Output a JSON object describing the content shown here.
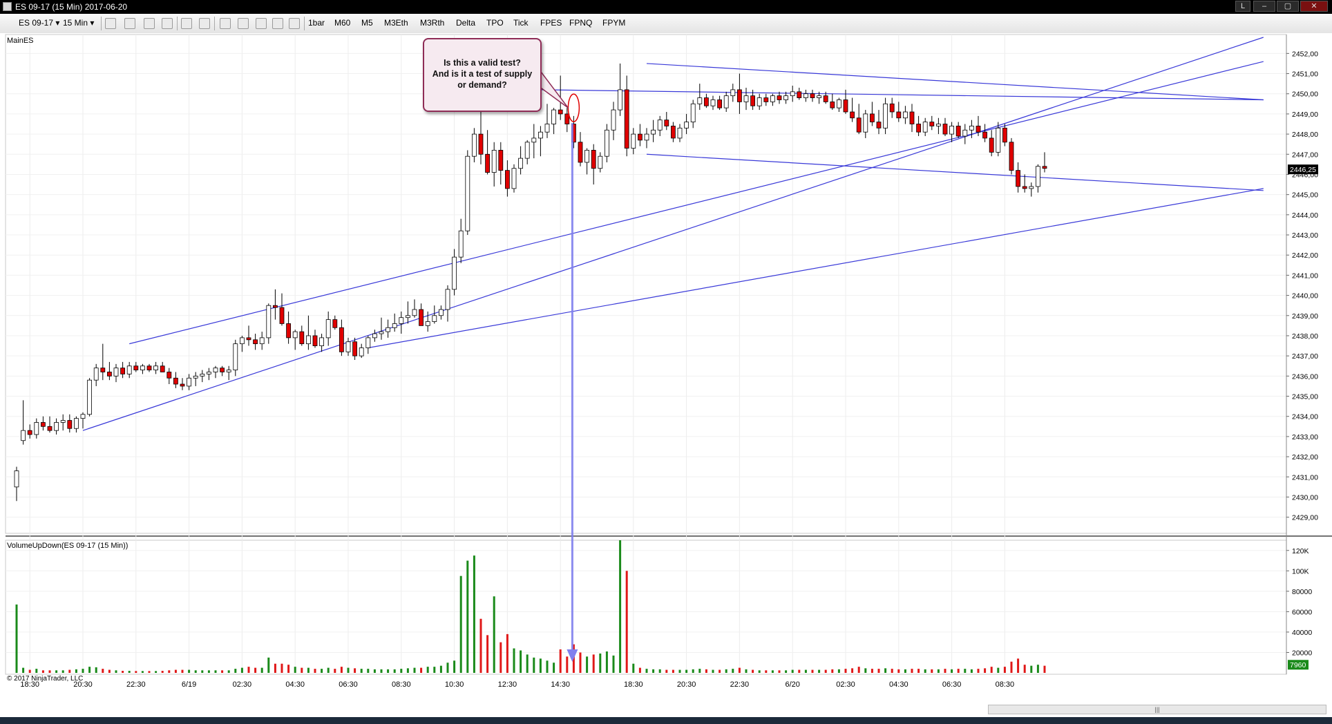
{
  "window": {
    "title": "ES 09-17 (15 Min)  2017-06-20",
    "buttons": [
      "L",
      "–",
      "▢",
      "✕"
    ]
  },
  "toolbar": {
    "instrument": "ES 09-17 ▾",
    "interval": "15 Min ▾",
    "buttons": [
      "1bar",
      "M60",
      "M5",
      "M3Eth",
      "M3Rth",
      "Delta",
      "TPO",
      "Tick",
      "FPES",
      "FPNQ",
      "FPYM"
    ]
  },
  "panels": {
    "price_label": "MainES",
    "volume_label": "VolumeUpDown(ES 09-17 (15 Min))",
    "copyright": "© 2017 NinjaTrader, LLC"
  },
  "callout": {
    "line1": "Is this a valid test?",
    "line2": "And is it a test of supply",
    "line3": "or demand?"
  },
  "chart_data": {
    "type": "candlestick",
    "x_tick_labels": [
      {
        "index": 2,
        "label": "18:30"
      },
      {
        "index": 10,
        "label": "20:30"
      },
      {
        "index": 18,
        "label": "22:30"
      },
      {
        "index": 26,
        "label": "6/19"
      },
      {
        "index": 34,
        "label": "02:30"
      },
      {
        "index": 42,
        "label": "04:30"
      },
      {
        "index": 50,
        "label": "06:30"
      },
      {
        "index": 58,
        "label": "08:30"
      },
      {
        "index": 66,
        "label": "10:30"
      },
      {
        "index": 74,
        "label": "12:30"
      },
      {
        "index": 82,
        "label": "14:30"
      },
      {
        "index": 93,
        "label": "18:30"
      },
      {
        "index": 101,
        "label": "20:30"
      },
      {
        "index": 109,
        "label": "22:30"
      },
      {
        "index": 117,
        "label": "6/20"
      },
      {
        "index": 125,
        "label": "02:30"
      },
      {
        "index": 133,
        "label": "04:30"
      },
      {
        "index": 141,
        "label": "06:30"
      },
      {
        "index": 149,
        "label": "08:30"
      }
    ],
    "price_axis": {
      "ylim": [
        2428.2,
        2452.8
      ],
      "ticks": [
        "2429,00",
        "2430,00",
        "2431,00",
        "2432,00",
        "2433,00",
        "2434,00",
        "2435,00",
        "2436,00",
        "2437,00",
        "2438,00",
        "2439,00",
        "2440,00",
        "2441,00",
        "2442,00",
        "2443,00",
        "2444,00",
        "2445,00",
        "2446,00",
        "2447,00",
        "2448,00",
        "2449,00",
        "2450,00",
        "2451,00",
        "2452,00"
      ],
      "last_price": "2446,25"
    },
    "volume_axis": {
      "ylim": [
        0,
        130000
      ],
      "ticks": [
        "20000",
        "40000",
        "60000",
        "80000",
        "100K",
        "120K"
      ],
      "last_volume": "7960"
    },
    "bars": [
      [
        2430.5,
        2431.5,
        2429.8,
        2431.3,
        67000
      ],
      [
        2432.8,
        2434.8,
        2432.6,
        2433.3,
        5000
      ],
      [
        2433.3,
        2433.6,
        2432.9,
        2433.1,
        3000
      ],
      [
        2433.1,
        2433.9,
        2432.9,
        2433.7,
        4000
      ],
      [
        2433.7,
        2434.0,
        2433.3,
        2433.5,
        2500
      ],
      [
        2433.5,
        2434.0,
        2433.2,
        2433.3,
        2500
      ],
      [
        2433.3,
        2433.9,
        2433.1,
        2433.7,
        2500
      ],
      [
        2433.7,
        2434.1,
        2433.3,
        2433.8,
        2500
      ],
      [
        2433.8,
        2434.1,
        2433.2,
        2433.4,
        3000
      ],
      [
        2433.4,
        2434.0,
        2433.2,
        2433.9,
        3500
      ],
      [
        2433.9,
        2434.2,
        2433.4,
        2434.1,
        4000
      ],
      [
        2434.1,
        2435.9,
        2434.0,
        2435.8,
        6000
      ],
      [
        2435.8,
        2436.6,
        2435.5,
        2436.4,
        5500
      ],
      [
        2436.4,
        2437.6,
        2435.8,
        2436.2,
        4000
      ],
      [
        2436.2,
        2436.7,
        2435.8,
        2436.0,
        3000
      ],
      [
        2436.0,
        2436.6,
        2435.7,
        2436.4,
        2500
      ],
      [
        2436.4,
        2436.7,
        2435.9,
        2436.1,
        2000
      ],
      [
        2436.1,
        2436.7,
        2435.9,
        2436.5,
        2000
      ],
      [
        2436.5,
        2436.7,
        2436.2,
        2436.3,
        1800
      ],
      [
        2436.3,
        2436.6,
        2436.1,
        2436.5,
        1800
      ],
      [
        2436.5,
        2436.6,
        2436.2,
        2436.3,
        1800
      ],
      [
        2436.3,
        2436.7,
        2436.1,
        2436.5,
        1800
      ],
      [
        2436.5,
        2436.7,
        2436.2,
        2436.2,
        2000
      ],
      [
        2436.2,
        2436.4,
        2435.6,
        2435.9,
        2500
      ],
      [
        2435.9,
        2436.2,
        2435.4,
        2435.6,
        3000
      ],
      [
        2435.6,
        2435.9,
        2435.3,
        2435.5,
        3000
      ],
      [
        2435.5,
        2436.1,
        2435.3,
        2435.9,
        3000
      ],
      [
        2435.9,
        2436.2,
        2435.5,
        2436.0,
        2500
      ],
      [
        2436.0,
        2436.3,
        2435.7,
        2436.1,
        2500
      ],
      [
        2436.1,
        2436.4,
        2435.8,
        2436.2,
        2500
      ],
      [
        2436.2,
        2436.5,
        2435.9,
        2436.4,
        2500
      ],
      [
        2436.4,
        2436.5,
        2436.0,
        2436.2,
        2500
      ],
      [
        2436.2,
        2436.5,
        2435.8,
        2436.3,
        2500
      ],
      [
        2436.3,
        2437.8,
        2436.0,
        2437.6,
        4000
      ],
      [
        2437.6,
        2438.0,
        2437.2,
        2437.9,
        5000
      ],
      [
        2437.9,
        2438.5,
        2437.5,
        2437.8,
        6000
      ],
      [
        2437.8,
        2438.1,
        2437.3,
        2437.6,
        5000
      ],
      [
        2437.6,
        2438.2,
        2437.3,
        2437.9,
        5000
      ],
      [
        2437.9,
        2439.6,
        2437.6,
        2439.5,
        15000
      ],
      [
        2439.5,
        2440.3,
        2438.8,
        2439.4,
        9000
      ],
      [
        2439.4,
        2440.1,
        2438.5,
        2438.6,
        9000
      ],
      [
        2438.6,
        2439.2,
        2437.6,
        2437.9,
        8000
      ],
      [
        2437.9,
        2438.3,
        2437.3,
        2438.2,
        6000
      ],
      [
        2438.2,
        2438.5,
        2437.5,
        2437.6,
        5000
      ],
      [
        2437.6,
        2439.0,
        2437.3,
        2438.0,
        5000
      ],
      [
        2438.0,
        2438.3,
        2437.4,
        2437.5,
        4000
      ],
      [
        2437.5,
        2438.1,
        2437.2,
        2437.9,
        4000
      ],
      [
        2437.9,
        2439.2,
        2437.5,
        2438.8,
        5000
      ],
      [
        2438.8,
        2439.0,
        2438.3,
        2438.4,
        4000
      ],
      [
        2438.4,
        2438.8,
        2437.0,
        2437.2,
        6000
      ],
      [
        2437.2,
        2437.9,
        2437.0,
        2437.7,
        5000
      ],
      [
        2437.7,
        2437.9,
        2436.8,
        2437.0,
        4500
      ],
      [
        2437.0,
        2437.6,
        2436.9,
        2437.4,
        4000
      ],
      [
        2437.4,
        2438.0,
        2437.1,
        2437.9,
        4000
      ],
      [
        2437.9,
        2438.3,
        2437.7,
        2438.1,
        3500
      ],
      [
        2438.1,
        2438.9,
        2437.8,
        2438.2,
        3500
      ],
      [
        2438.2,
        2438.8,
        2437.9,
        2438.4,
        3500
      ],
      [
        2438.4,
        2439.1,
        2438.2,
        2438.6,
        3500
      ],
      [
        2438.6,
        2439.2,
        2438.1,
        2438.9,
        4000
      ],
      [
        2438.9,
        2439.7,
        2438.6,
        2439.0,
        4500
      ],
      [
        2439.0,
        2439.8,
        2438.9,
        2439.3,
        5000
      ],
      [
        2439.3,
        2439.6,
        2438.5,
        2438.5,
        5000
      ],
      [
        2438.5,
        2439.2,
        2438.2,
        2438.7,
        6000
      ],
      [
        2438.7,
        2439.5,
        2438.6,
        2439.0,
        6000
      ],
      [
        2439.0,
        2439.5,
        2438.8,
        2439.3,
        7000
      ],
      [
        2439.3,
        2440.5,
        2438.7,
        2440.3,
        10000
      ],
      [
        2440.3,
        2442.3,
        2440.0,
        2441.9,
        12000
      ],
      [
        2441.9,
        2443.8,
        2441.6,
        2443.2,
        95000
      ],
      [
        2443.2,
        2447.2,
        2443.0,
        2446.9,
        110000
      ],
      [
        2446.9,
        2448.3,
        2446.6,
        2448.0,
        115000
      ],
      [
        2448.0,
        2449.5,
        2446.5,
        2447.0,
        53000
      ],
      [
        2447.0,
        2448.2,
        2446.0,
        2446.1,
        37000
      ],
      [
        2446.1,
        2447.6,
        2445.4,
        2447.2,
        75000
      ],
      [
        2447.2,
        2447.6,
        2445.5,
        2446.2,
        30000
      ],
      [
        2446.2,
        2446.7,
        2444.9,
        2445.3,
        38000
      ],
      [
        2445.3,
        2446.5,
        2445.1,
        2446.3,
        24000
      ],
      [
        2446.3,
        2447.4,
        2446.0,
        2446.8,
        22000
      ],
      [
        2446.8,
        2447.7,
        2446.5,
        2447.6,
        18000
      ],
      [
        2447.6,
        2448.5,
        2446.8,
        2447.8,
        15000
      ],
      [
        2447.8,
        2448.4,
        2446.9,
        2448.1,
        14000
      ],
      [
        2448.1,
        2449.5,
        2447.8,
        2448.5,
        12000
      ],
      [
        2448.5,
        2449.3,
        2448.0,
        2449.2,
        10000
      ],
      [
        2449.2,
        2450.9,
        2448.7,
        2449.0,
        23000
      ],
      [
        2449.0,
        2449.3,
        2448.1,
        2448.5,
        16000
      ],
      [
        2448.5,
        2448.9,
        2447.3,
        2447.6,
        28000
      ],
      [
        2447.6,
        2448.1,
        2446.4,
        2446.6,
        20000
      ],
      [
        2446.6,
        2447.3,
        2446.0,
        2447.2,
        16000
      ],
      [
        2447.2,
        2447.5,
        2445.5,
        2446.3,
        18000
      ],
      [
        2446.3,
        2447.1,
        2446.1,
        2446.9,
        19000
      ],
      [
        2446.9,
        2448.5,
        2446.6,
        2448.2,
        21000
      ],
      [
        2448.2,
        2449.6,
        2447.7,
        2449.2,
        17000
      ],
      [
        2449.2,
        2451.5,
        2448.9,
        2450.2,
        130000
      ],
      [
        2450.2,
        2450.9,
        2446.9,
        2447.3,
        100000
      ],
      [
        2447.3,
        2448.3,
        2447.0,
        2448.0,
        9000
      ],
      [
        2448.0,
        2448.5,
        2447.4,
        2447.7,
        5000
      ],
      [
        2447.7,
        2448.3,
        2447.3,
        2448.0,
        4000
      ],
      [
        2448.0,
        2448.7,
        2447.6,
        2448.2,
        3500
      ],
      [
        2448.2,
        2448.9,
        2447.9,
        2448.7,
        3500
      ],
      [
        2448.7,
        2449.1,
        2448.2,
        2448.4,
        3000
      ],
      [
        2448.4,
        2448.6,
        2447.6,
        2447.8,
        3000
      ],
      [
        2447.8,
        2448.5,
        2447.6,
        2448.3,
        3000
      ],
      [
        2448.3,
        2449.0,
        2448.0,
        2448.6,
        3000
      ],
      [
        2448.6,
        2449.7,
        2448.3,
        2449.5,
        3500
      ],
      [
        2449.5,
        2450.5,
        2449.2,
        2449.8,
        4000
      ],
      [
        2449.8,
        2450.0,
        2449.3,
        2449.4,
        3500
      ],
      [
        2449.4,
        2449.9,
        2449.2,
        2449.7,
        3000
      ],
      [
        2449.7,
        2449.9,
        2449.2,
        2449.3,
        3000
      ],
      [
        2449.3,
        2450.1,
        2449.1,
        2449.9,
        3500
      ],
      [
        2449.9,
        2450.5,
        2449.6,
        2450.2,
        4000
      ],
      [
        2450.2,
        2451.0,
        2449.0,
        2449.6,
        5000
      ],
      [
        2449.6,
        2450.3,
        2449.2,
        2449.9,
        3500
      ],
      [
        2449.9,
        2450.2,
        2449.2,
        2449.4,
        3000
      ],
      [
        2449.4,
        2450.0,
        2449.2,
        2449.8,
        2500
      ],
      [
        2449.8,
        2450.0,
        2449.4,
        2449.6,
        2500
      ],
      [
        2449.6,
        2450.0,
        2449.4,
        2449.9,
        2500
      ],
      [
        2449.9,
        2450.1,
        2449.5,
        2449.7,
        2500
      ],
      [
        2449.7,
        2450.1,
        2449.5,
        2449.9,
        2500
      ],
      [
        2449.9,
        2450.4,
        2449.6,
        2450.1,
        3000
      ],
      [
        2450.1,
        2450.3,
        2449.7,
        2449.8,
        3000
      ],
      [
        2449.8,
        2450.2,
        2449.6,
        2450.0,
        3000
      ],
      [
        2450.0,
        2450.2,
        2449.6,
        2449.8,
        3000
      ],
      [
        2449.8,
        2450.1,
        2449.5,
        2449.9,
        3000
      ],
      [
        2449.9,
        2450.1,
        2449.5,
        2449.6,
        3000
      ],
      [
        2449.6,
        2450.0,
        2449.2,
        2449.3,
        3500
      ],
      [
        2449.3,
        2449.8,
        2449.1,
        2449.7,
        3500
      ],
      [
        2449.7,
        2450.2,
        2449.0,
        2449.1,
        4000
      ],
      [
        2449.1,
        2449.8,
        2448.6,
        2448.8,
        4500
      ],
      [
        2448.8,
        2449.5,
        2448.0,
        2448.1,
        6000
      ],
      [
        2448.1,
        2449.2,
        2447.8,
        2449.0,
        4500
      ],
      [
        2449.0,
        2449.6,
        2448.4,
        2448.6,
        4000
      ],
      [
        2448.6,
        2449.2,
        2448.0,
        2448.3,
        4000
      ],
      [
        2448.3,
        2449.8,
        2448.0,
        2449.5,
        4500
      ],
      [
        2449.5,
        2449.8,
        2448.8,
        2449.1,
        4000
      ],
      [
        2449.1,
        2449.6,
        2448.6,
        2448.8,
        3500
      ],
      [
        2448.8,
        2449.4,
        2448.5,
        2449.1,
        3500
      ],
      [
        2449.1,
        2449.5,
        2448.1,
        2448.5,
        4000
      ],
      [
        2448.5,
        2448.9,
        2447.9,
        2448.1,
        4000
      ],
      [
        2448.1,
        2448.8,
        2447.9,
        2448.6,
        3500
      ],
      [
        2448.6,
        2448.9,
        2448.2,
        2448.4,
        3500
      ],
      [
        2448.4,
        2448.8,
        2448.0,
        2448.5,
        3500
      ],
      [
        2448.5,
        2448.8,
        2447.9,
        2448.0,
        4000
      ],
      [
        2448.0,
        2448.6,
        2447.6,
        2448.4,
        3500
      ],
      [
        2448.4,
        2448.6,
        2447.8,
        2447.9,
        4000
      ],
      [
        2447.9,
        2448.5,
        2447.5,
        2448.2,
        4000
      ],
      [
        2448.2,
        2448.7,
        2447.8,
        2448.4,
        3500
      ],
      [
        2448.4,
        2448.9,
        2447.9,
        2448.1,
        4000
      ],
      [
        2448.1,
        2448.5,
        2447.6,
        2447.8,
        4500
      ],
      [
        2447.8,
        2448.2,
        2446.9,
        2447.1,
        6000
      ],
      [
        2447.1,
        2448.6,
        2446.9,
        2448.3,
        5000
      ],
      [
        2448.3,
        2448.5,
        2447.4,
        2447.6,
        6000
      ],
      [
        2447.6,
        2447.8,
        2446.0,
        2446.2,
        11000
      ],
      [
        2446.2,
        2446.6,
        2445.1,
        2445.4,
        14000
      ],
      [
        2445.4,
        2446.0,
        2445.1,
        2445.3,
        8000
      ],
      [
        2445.3,
        2445.6,
        2444.9,
        2445.4,
        7000
      ],
      [
        2445.4,
        2446.5,
        2445.1,
        2446.4,
        8000
      ],
      [
        2446.4,
        2447.1,
        2446.1,
        2446.3,
        7000
      ]
    ],
    "trendlines": [
      {
        "from": [
          10,
          2433.3
        ],
        "to": [
          188,
          2452.8
        ]
      },
      {
        "from": [
          17,
          2437.6
        ],
        "to": [
          188,
          2451.6
        ]
      },
      {
        "from": [
          79,
          2450.2
        ],
        "to": [
          188,
          2449.7
        ]
      },
      {
        "from": [
          95,
          2451.5
        ],
        "to": [
          188,
          2449.7
        ]
      },
      {
        "from": [
          95,
          2447.0
        ],
        "to": [
          188,
          2445.2
        ]
      },
      {
        "from": [
          53,
          2437.4
        ],
        "to": [
          188,
          2445.3
        ]
      }
    ],
    "callout_target": {
      "index": 84,
      "price": 2449.3
    }
  }
}
